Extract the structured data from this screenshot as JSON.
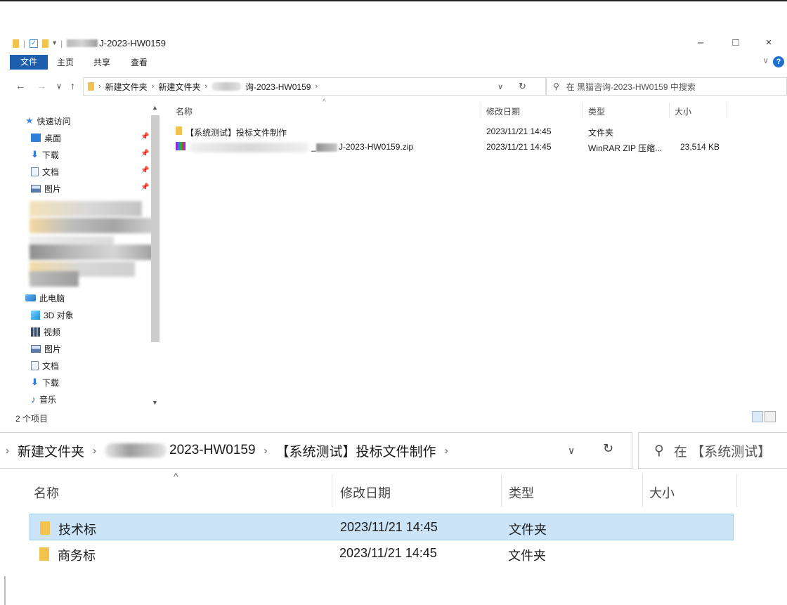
{
  "window": {
    "title": "J-2023-HW0159",
    "controls": {
      "minimize": "–",
      "maximize": "□",
      "close": "×"
    }
  },
  "ribbon": {
    "tabs": [
      "文件",
      "主页",
      "共享",
      "查看"
    ],
    "expand": "∨",
    "help": "?"
  },
  "nav": {
    "back": "←",
    "forward": "→",
    "recent": "∨",
    "up": "↑",
    "breadcrumbs": [
      "新建文件夹",
      "新建文件夹",
      "询-2023-HW0159"
    ],
    "dropdown": "∨",
    "refresh": "↻",
    "search_placeholder": "在 黑猫咨询-2023-HW0159 中搜索"
  },
  "sidebar": {
    "quick_access": "快速访问",
    "quick_items": [
      {
        "label": "桌面",
        "icon": "desktop-icon"
      },
      {
        "label": "下载",
        "icon": "download-icon"
      },
      {
        "label": "文档",
        "icon": "document-icon"
      },
      {
        "label": "图片",
        "icon": "picture-icon"
      }
    ],
    "this_pc": "此电脑",
    "pc_items": [
      {
        "label": "3D 对象",
        "icon": "3d-objects-icon"
      },
      {
        "label": "视频",
        "icon": "video-icon"
      },
      {
        "label": "图片",
        "icon": "picture-icon"
      },
      {
        "label": "文档",
        "icon": "document-icon"
      },
      {
        "label": "下载",
        "icon": "download-icon"
      },
      {
        "label": "音乐",
        "icon": "music-icon"
      }
    ]
  },
  "file_list": {
    "columns": [
      "名称",
      "修改日期",
      "类型",
      "大小"
    ],
    "rows": [
      {
        "name": "【系统测试】投标文件制作",
        "date": "2023/11/21 14:45",
        "type": "文件夹",
        "size": ""
      },
      {
        "name_prefix": "_",
        "name": "J-2023-HW0159.zip",
        "date": "2023/11/21 14:45",
        "type": "WinRAR ZIP 压缩...",
        "size": "23,514 KB"
      }
    ]
  },
  "status": {
    "item_count": "2 个项目"
  },
  "zoomed": {
    "breadcrumbs": [
      "新建文件夹",
      "2023-HW0159",
      "【系统测试】投标文件制作"
    ],
    "dropdown": "∨",
    "refresh": "↻",
    "search_text": "在 【系统测试】",
    "columns": [
      "名称",
      "修改日期",
      "类型",
      "大小"
    ],
    "rows": [
      {
        "name": "技术标",
        "date": "2023/11/21 14:45",
        "type": "文件夹",
        "selected": true
      },
      {
        "name": "商务标",
        "date": "2023/11/21 14:45",
        "type": "文件夹",
        "selected": false
      }
    ]
  },
  "colors": {
    "accent": "#1e5fad",
    "selection": "#cce4f7",
    "folder": "#f2c14e"
  }
}
